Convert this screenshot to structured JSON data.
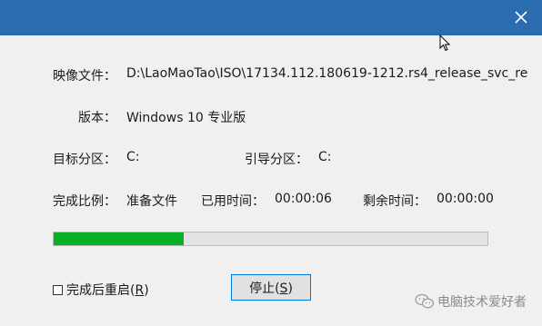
{
  "window": {
    "close_icon": "close-icon",
    "accent_color": "#2b6bb0"
  },
  "fields": {
    "image_label": "映像文件：",
    "image_value": "D:\\LaoMaoTao\\ISO\\17134.112.180619-1212.rs4_release_svc_re",
    "edition_label": "版本：",
    "edition_value": "Windows 10 专业版",
    "target_label": "目标分区：",
    "target_value": "C:",
    "boot_label": "引导分区：",
    "boot_value": "C:",
    "progress_label": "完成比例：",
    "progress_value": "准备文件",
    "elapsed_label": "已用时间：",
    "elapsed_value": "00:00:06",
    "remaining_label": "剩余时间：",
    "remaining_value": "00:00:00"
  },
  "progress": {
    "fraction": 0.3,
    "fill_color": "#06b025"
  },
  "controls": {
    "restart_checkbox_text": "完成后重启(",
    "restart_checkbox_key": "R",
    "restart_checkbox_close": ")",
    "restart_checked": false,
    "stop_text": "停止(",
    "stop_key": "S",
    "stop_close": ")"
  },
  "watermark": {
    "icon": "wechat-icon",
    "text": "电脑技术爱好者"
  }
}
